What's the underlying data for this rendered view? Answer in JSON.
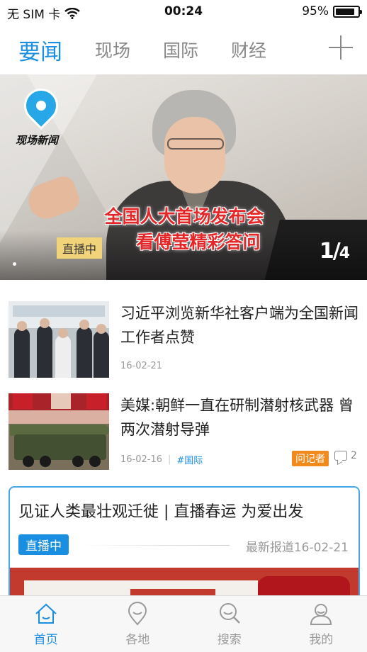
{
  "status_bar": {
    "carrier": "无 SIM 卡",
    "time": "00:24",
    "battery": "95%",
    "battery_level": 0.95,
    "wifi_icon": "wifi-icon",
    "battery_icon": "battery-icon"
  },
  "tabs": {
    "items": [
      {
        "label": "要闻",
        "active": true
      },
      {
        "label": "现场",
        "active": false
      },
      {
        "label": "国际",
        "active": false
      },
      {
        "label": "财经",
        "active": false
      }
    ],
    "add_icon": "plus-icon"
  },
  "hero": {
    "logo_text": "现场新闻",
    "headline_line1": "全国人大首场发布会",
    "headline_line2": "看傅莹精彩答问",
    "live_tag": "直播中",
    "pager_current": "1",
    "pager_total": "4"
  },
  "news": [
    {
      "title": "习近平浏览新华社客户端为全国新闻工作者点赞",
      "date": "16-02-21"
    },
    {
      "title": "美媒:朝鲜一直在研制潜射核武器 曾两次潜射导弹",
      "date": "16-02-16",
      "category": "#国际",
      "reporter_badge": "问记者",
      "comments": "2"
    }
  ],
  "live_card": {
    "title": "见证人类最壮观迁徙 | 直播春运 为爱出发",
    "badge": "直播中",
    "latest": "最新报道16-02-21"
  },
  "bottom_nav": [
    {
      "label": "首页",
      "icon": "home-icon",
      "active": true
    },
    {
      "label": "各地",
      "icon": "location-pin-icon",
      "active": false
    },
    {
      "label": "搜索",
      "icon": "search-icon",
      "active": false
    },
    {
      "label": "我的",
      "icon": "user-icon",
      "active": false
    }
  ],
  "colors": {
    "accent": "#1a8ee1",
    "reporter_badge": "#f08a1d",
    "headline_red": "#e4282a"
  }
}
